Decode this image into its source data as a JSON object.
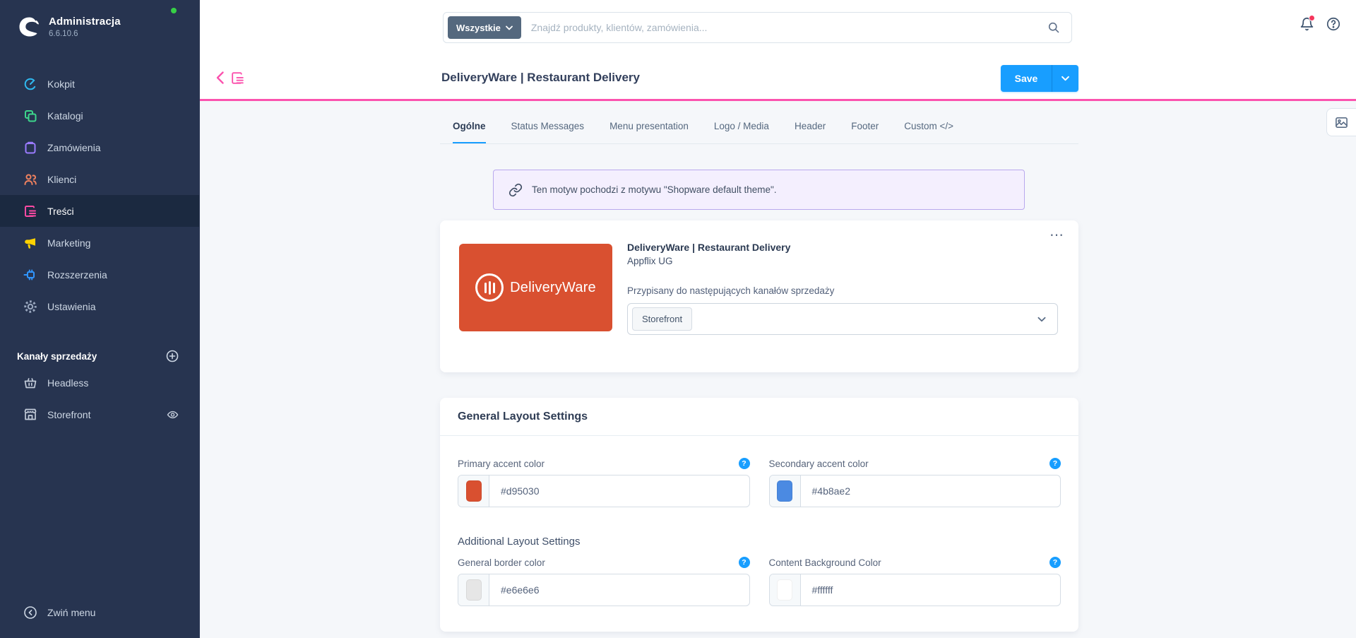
{
  "app": {
    "title": "Administracja",
    "version": "6.6.10.6"
  },
  "sidebar": {
    "items": [
      {
        "label": "Kokpit",
        "icon": "dashboard-icon"
      },
      {
        "label": "Katalogi",
        "icon": "catalog-icon"
      },
      {
        "label": "Zamówienia",
        "icon": "orders-icon"
      },
      {
        "label": "Klienci",
        "icon": "customers-icon"
      },
      {
        "label": "Treści",
        "icon": "content-icon"
      },
      {
        "label": "Marketing",
        "icon": "megaphone-icon"
      },
      {
        "label": "Rozszerzenia",
        "icon": "plugin-icon"
      },
      {
        "label": "Ustawienia",
        "icon": "gear-icon"
      }
    ],
    "channels_header": "Kanały sprzedaży",
    "channels": [
      {
        "label": "Headless",
        "icon": "basket-icon"
      },
      {
        "label": "Storefront",
        "icon": "storefront-icon"
      }
    ],
    "collapse_label": "Zwiń menu"
  },
  "topbar": {
    "filter_label": "Wszystkie",
    "search_placeholder": "Znajdź produkty, klientów, zamówienia..."
  },
  "smartbar": {
    "title": "DeliveryWare | Restaurant Delivery",
    "save_label": "Save"
  },
  "tabs": [
    {
      "label": "Ogólne",
      "active": true
    },
    {
      "label": "Status Messages",
      "active": false
    },
    {
      "label": "Menu presentation",
      "active": false
    },
    {
      "label": "Logo / Media",
      "active": false
    },
    {
      "label": "Header",
      "active": false
    },
    {
      "label": "Footer",
      "active": false
    },
    {
      "label": "Custom </>",
      "active": false
    }
  ],
  "banner": {
    "text": "Ten motyw pochodzi z motywu \"Shopware default theme\"."
  },
  "theme_card": {
    "logo_text": "DeliveryWare",
    "title": "DeliveryWare | Restaurant Delivery",
    "vendor": "Appflix UG",
    "channels_label": "Przypisany do następujących kanałów sprzedaży",
    "channel_tag": "Storefront",
    "menu_dots": "⋯"
  },
  "settings_card": {
    "title": "General Layout Settings",
    "subsection": "Additional Layout Settings",
    "fields": [
      {
        "label": "Primary accent color",
        "value": "#d95030",
        "swatch": "#d95030"
      },
      {
        "label": "Secondary accent color",
        "value": "#4b8ae2",
        "swatch": "#4b8ae2"
      },
      {
        "label": "General border color",
        "value": "#e6e6e6",
        "swatch": "#e6e6e6"
      },
      {
        "label": "Content Background Color",
        "value": "#ffffff",
        "swatch": "#ffffff"
      }
    ]
  },
  "colors": {
    "accent_pink": "#fb53ae",
    "brand_blue": "#189eff",
    "status_green": "#37d046",
    "notification_red": "#f5365c",
    "theme_orange": "#d95030",
    "sidebar_navy": "#273450"
  }
}
